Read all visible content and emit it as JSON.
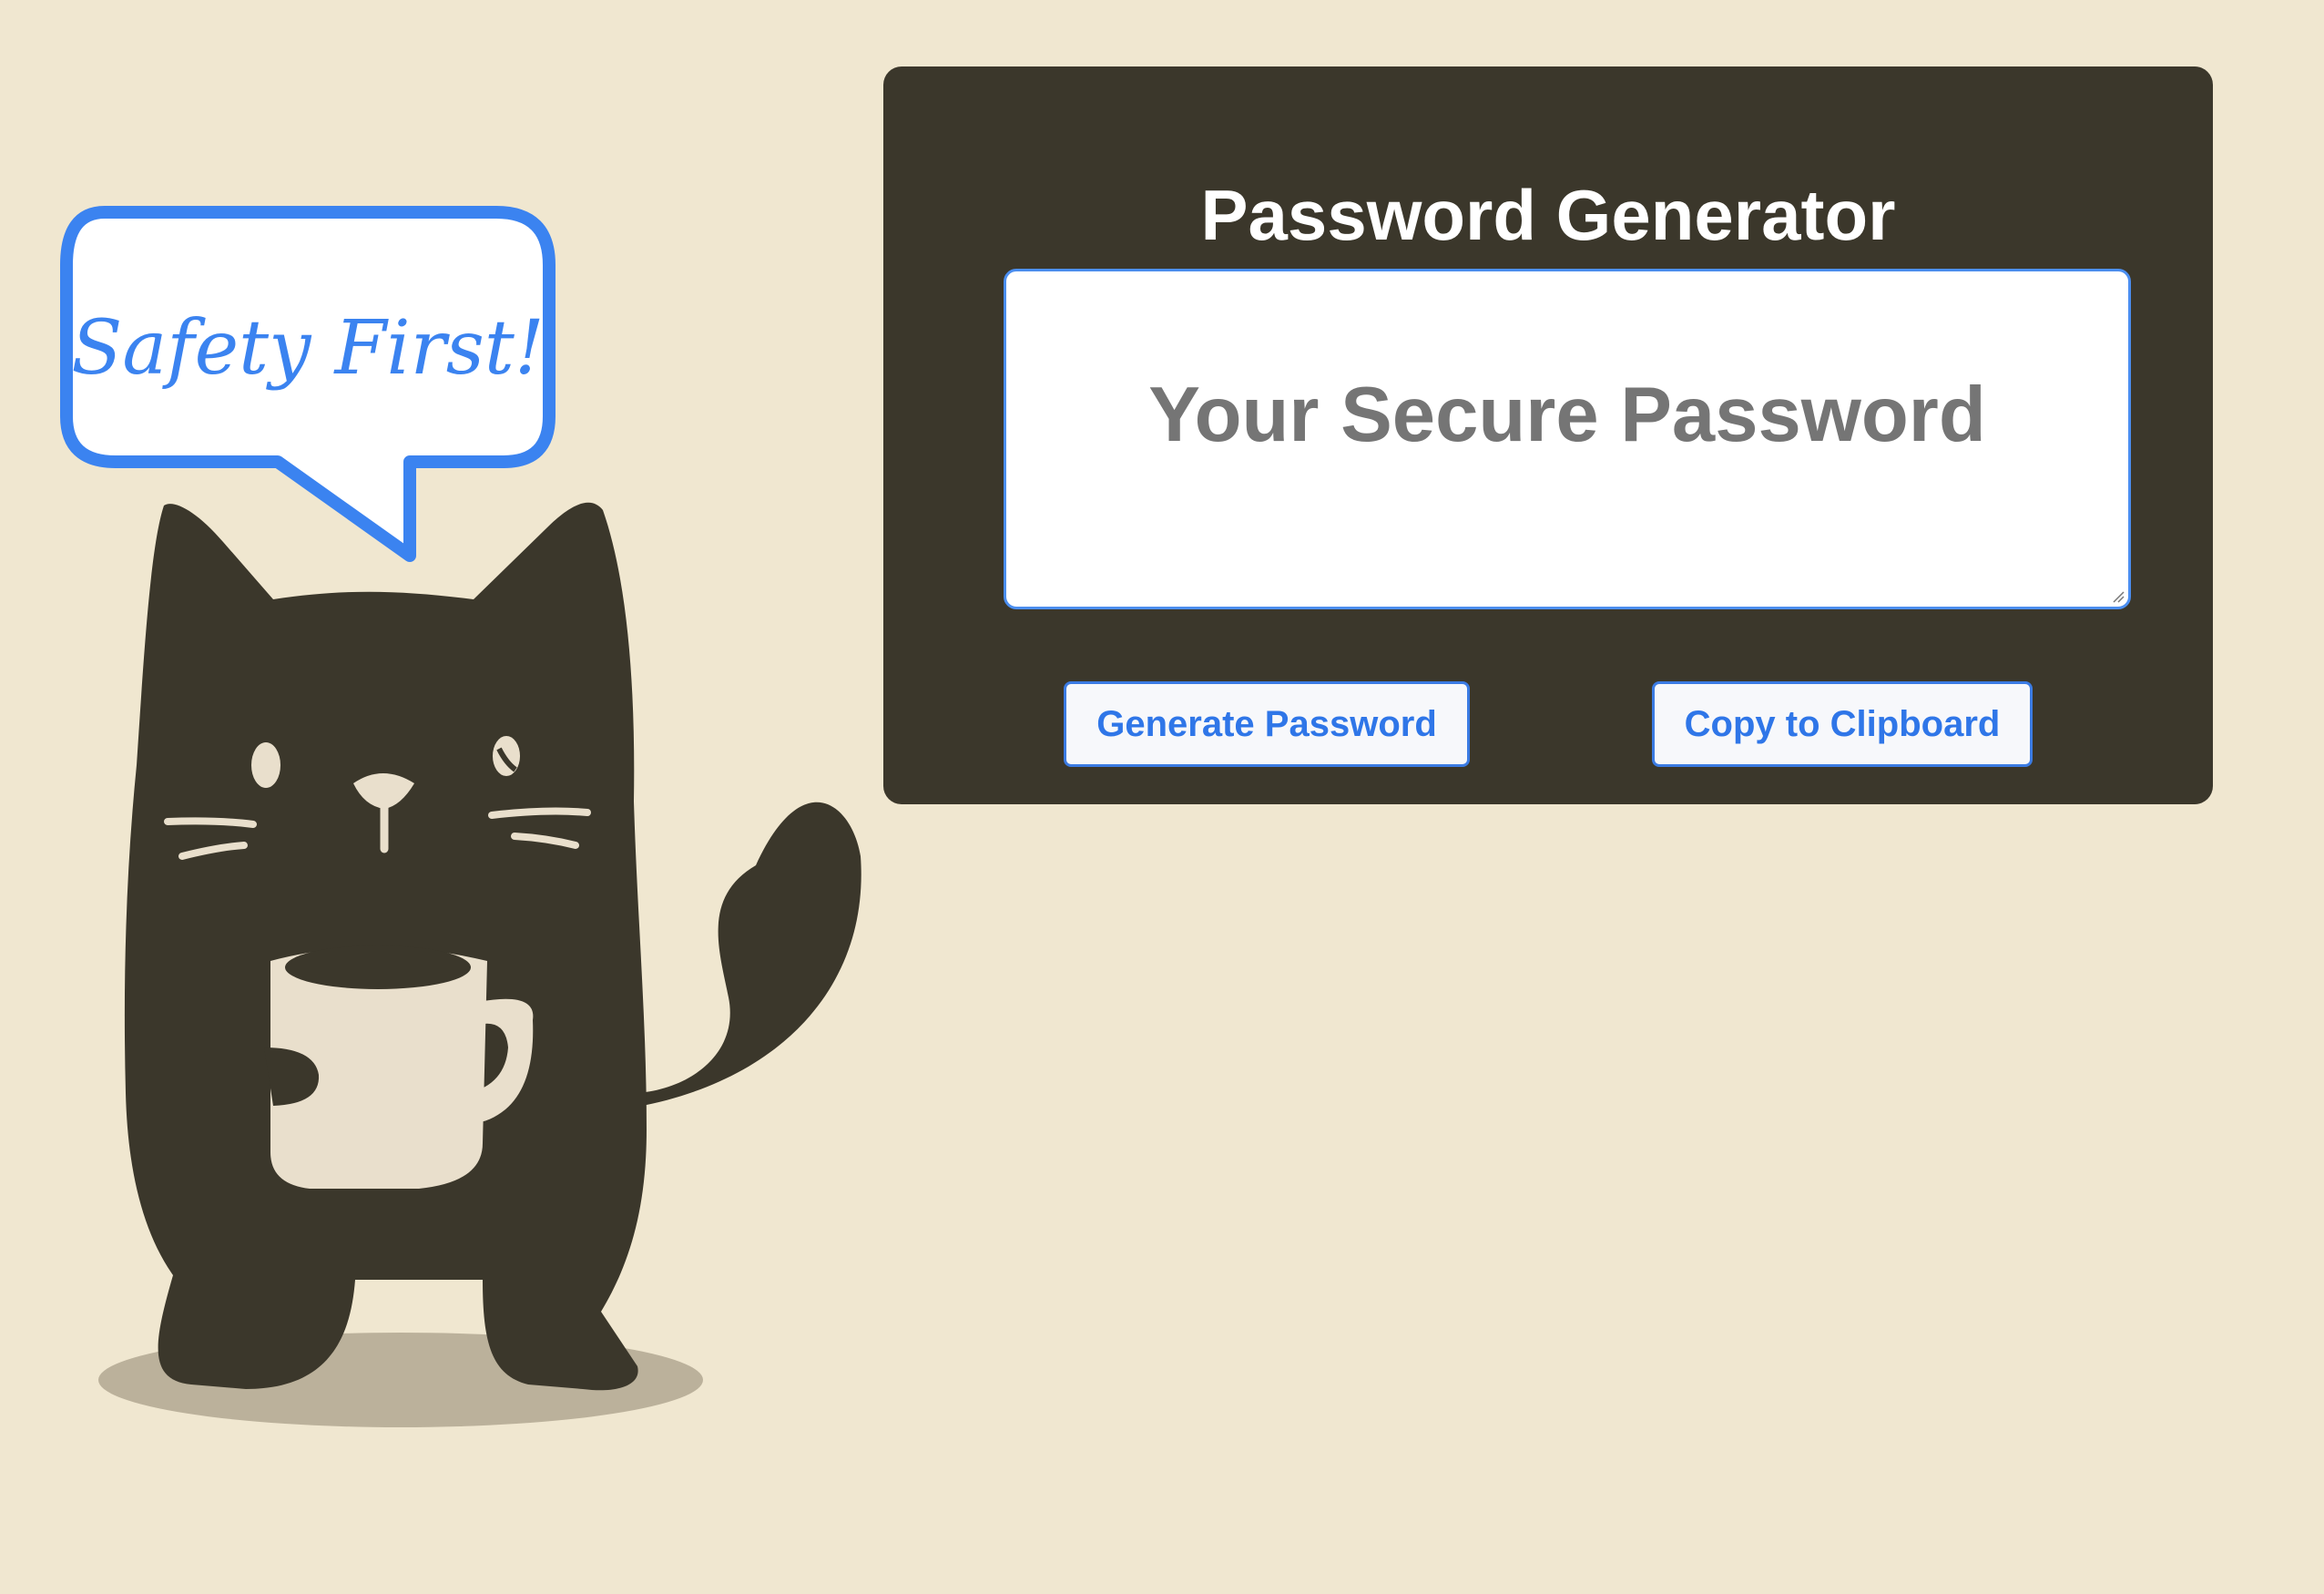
{
  "illustration": {
    "speech_bubble_text": "Safety First!"
  },
  "generator": {
    "title": "Password Generator",
    "password_placeholder": "Your Secure Password",
    "generate_label": "Generate Password",
    "copy_label": "Copy to Clipboard"
  },
  "colors": {
    "page_background": "#f0e7d0",
    "card_background": "#3b372b",
    "accent_blue": "#2f76e8",
    "cat_body": "#3b372b",
    "mug": "#e9dfcc"
  },
  "icons": [
    "cat-illustration",
    "speech-bubble",
    "coffee-mug",
    "resize-grip-icon"
  ]
}
